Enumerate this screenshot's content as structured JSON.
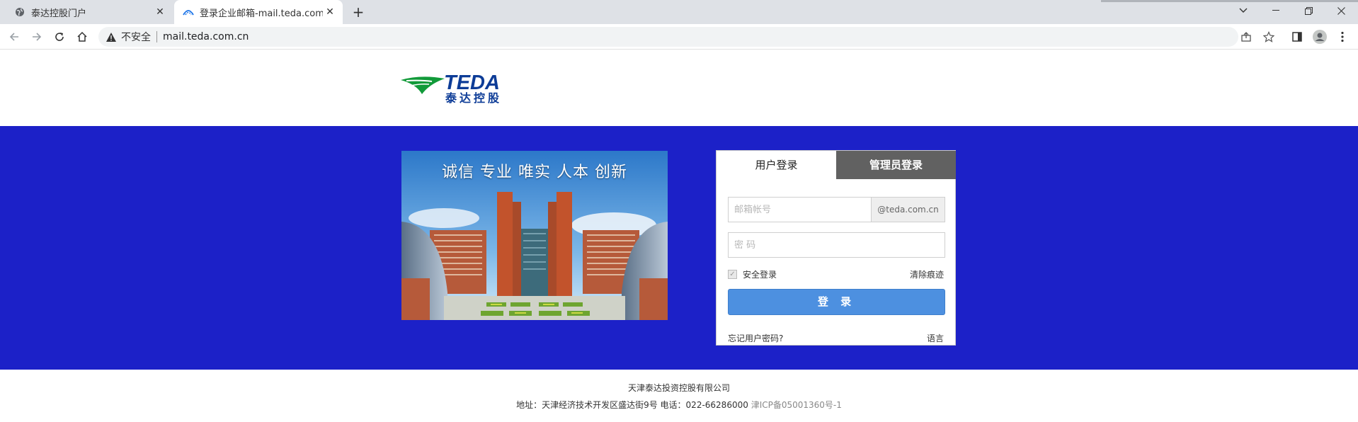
{
  "browser": {
    "tabs": [
      {
        "title": "泰达控股门户",
        "icon": "globe-icon"
      },
      {
        "title": "登录企业邮箱-mail.teda.com.cn",
        "icon": "mail-logo-icon"
      }
    ],
    "new_tab": "+",
    "insecure_label": "不安全",
    "url": "mail.teda.com.cn"
  },
  "header": {
    "logo_en": "TEDA",
    "logo_cn": "泰达控股"
  },
  "banner": {
    "slogan": "诚信 专业 唯实 人本 创新",
    "color": "#1c21c8"
  },
  "login": {
    "tab_user": "用户登录",
    "tab_admin": "管理员登录",
    "account_placeholder": "邮箱帐号",
    "domain_suffix": "@teda.com.cn",
    "password_placeholder": "密 码",
    "secure_login": "安全登录",
    "clear_traces": "清除痕迹",
    "submit": "登 录",
    "forgot": "忘记用户密码?",
    "language": "语言",
    "button_color": "#4d90e0"
  },
  "footer": {
    "company": "天津泰达投资控股有限公司",
    "address": "地址：天津经济技术开发区盛达街9号 电话：022-66286000",
    "icp": "津ICP备05001360号-1"
  }
}
